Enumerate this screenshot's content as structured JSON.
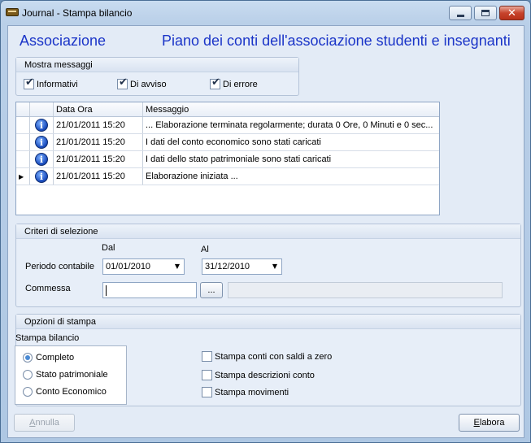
{
  "window": {
    "title": "Journal - Stampa bilancio",
    "minimize_icon": "minimize-icon",
    "maximize_icon": "maximize-icon",
    "close_icon": "close-icon"
  },
  "header": {
    "left": "Associazione",
    "right": "Piano dei conti dell'associazione studenti e insegnanti",
    "color": "#1b35c8"
  },
  "messages_filter": {
    "title": "Mostra messaggi",
    "options": [
      {
        "label": "Informativi",
        "checked": true
      },
      {
        "label": "Di avviso",
        "checked": true
      },
      {
        "label": "Di errore",
        "checked": true
      }
    ]
  },
  "log_grid": {
    "columns": [
      "",
      "",
      "Data Ora",
      "Messaggio"
    ],
    "rows": [
      {
        "icon": "info-icon",
        "datetime": "21/01/2011 15:20",
        "message": "... Elaborazione terminata regolarmente; durata 0 Ore, 0 Minuti e 0 sec...",
        "current": false
      },
      {
        "icon": "info-icon",
        "datetime": "21/01/2011 15:20",
        "message": "I dati del conto economico sono stati caricati",
        "current": false
      },
      {
        "icon": "info-icon",
        "datetime": "21/01/2011 15:20",
        "message": "I dati dello stato patrimoniale sono stati caricati",
        "current": false
      },
      {
        "icon": "info-icon",
        "datetime": "21/01/2011 15:20",
        "message": "Elaborazione iniziata ...",
        "current": true
      }
    ]
  },
  "selection": {
    "title": "Criteri di selezione",
    "from_label": "Dal",
    "to_label": "Al",
    "period_label": "Periodo contabile",
    "from_value": "01/01/2010",
    "to_value": "31/12/2010",
    "job_label": "Commessa",
    "job_value": "",
    "browse_label": "...",
    "job_description": ""
  },
  "print_options": {
    "title": "Opzioni di stampa",
    "balance_label": "Stampa bilancio",
    "balance_options": [
      {
        "label": "Completo",
        "selected": true
      },
      {
        "label": "Stato patrimoniale",
        "selected": false
      },
      {
        "label": "Conto Economico",
        "selected": false
      }
    ],
    "flags": [
      {
        "label": "Stampa conti con saldi a zero",
        "checked": false
      },
      {
        "label": "Stampa descrizioni conto",
        "checked": false
      },
      {
        "label": "Stampa movimenti",
        "checked": false
      }
    ]
  },
  "footer": {
    "cancel_first": "A",
    "cancel_rest": "nnulla",
    "process_first": "E",
    "process_rest": "labora"
  }
}
